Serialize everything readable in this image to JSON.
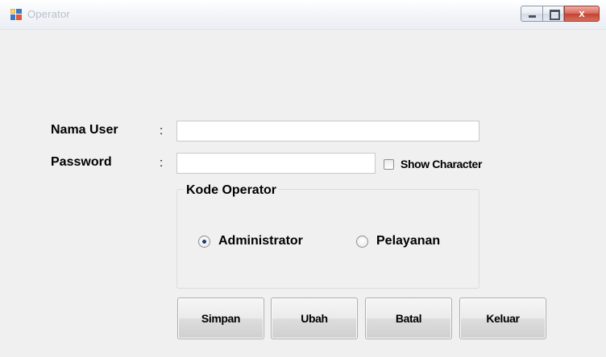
{
  "window": {
    "title": "Operator",
    "icon": "form-app-icon",
    "controls": {
      "minimize_icon": "minimize-icon",
      "maximize_icon": "maximize-icon",
      "close_icon": "close-icon",
      "close_glyph": "x"
    },
    "colors": {
      "close_button": "#c54131",
      "background": "#f0f0f0"
    }
  },
  "form": {
    "nama_user": {
      "label": "Nama User",
      "separator": ":",
      "value": ""
    },
    "password": {
      "label": "Password",
      "separator": ":",
      "value": ""
    },
    "show_character": {
      "label": "Show Character",
      "checked": false
    },
    "kode_operator": {
      "title": "Kode Operator",
      "options": [
        {
          "label": "Administrator",
          "selected": true
        },
        {
          "label": "Pelayanan",
          "selected": false
        }
      ]
    }
  },
  "buttons": {
    "simpan": "Simpan",
    "ubah": "Ubah",
    "batal": "Batal",
    "keluar": "Keluar"
  }
}
